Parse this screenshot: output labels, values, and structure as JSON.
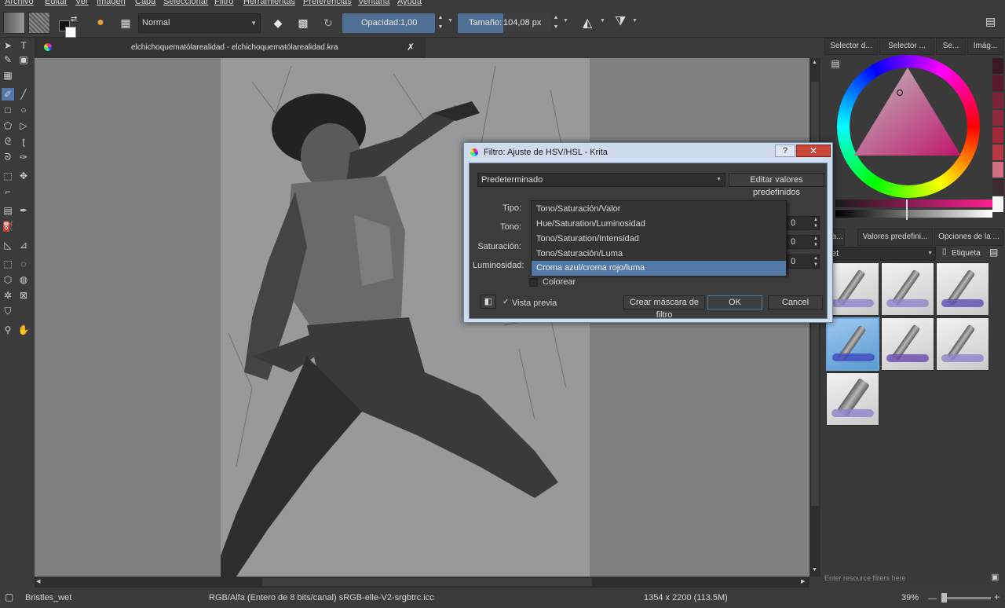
{
  "menu": [
    "Archivo",
    "Editar",
    "Ver",
    "Imagen",
    "Capa",
    "Seleccionar",
    "Filtro",
    "Herramientas",
    "Preferencias",
    "Ventana",
    "Ayuda"
  ],
  "toolbar": {
    "blend_mode": "Normal",
    "opacity_label": "Opacidad:",
    "opacity_value": "1,00",
    "size_label": "Tamaño:",
    "size_value": "104,08 px"
  },
  "document": {
    "tab_title": "elchichoquematólarealidad - elchichoquematólarealidad.kra"
  },
  "right_panel": {
    "top_tabs": [
      "Selector d...",
      "Selector ...",
      "Se...",
      "Imág..."
    ],
    "preset_tabs": [
      "Ca...",
      "Valores predefini...",
      "Opciones de la ..."
    ],
    "preset_filter_value": "et",
    "tag_label": "Etiqueta",
    "resource_filter_placeholder": "Enter resource filters here",
    "swatch_colors": [
      "#3a1a22",
      "#5a1a2a",
      "#7a2638",
      "#8a2c3c",
      "#a02a3a",
      "#b83848",
      "#d07080",
      "#3b2a2e",
      "#f5f5f5"
    ]
  },
  "dialog": {
    "title": "Filtro: Ajuste de HSV/HSL - Krita",
    "preset_value": "Predeterminado",
    "edit_presets_button": "Editar valores predefinidos",
    "type_label": "Tipo:",
    "hue_label": "Tono:",
    "saturation_label": "Saturación:",
    "luminosity_label": "Luminosidad:",
    "hue_value": "0",
    "saturation_value": "0",
    "luminosity_value": "0",
    "colorize_label": "Colorear",
    "preview_label": "Vista previa",
    "preview_checked": true,
    "mask_button": "Crear máscara de filtro",
    "ok_button": "OK",
    "cancel_button": "Cancel",
    "type_options": [
      "Tono/Saturación/Valor",
      "Hue/Saturation/Luminosidad",
      "Tono/Saturation/Intensidad",
      "Tono/Saturación/Luma",
      "Croma azul/croma rojo/luma"
    ],
    "selected_option_index": 4
  },
  "status": {
    "brush_name": "Bristles_wet",
    "color_model": "RGB/Alfa (Entero de 8 bits/canal)  sRGB-elle-V2-srgbtrc.icc",
    "dimensions": "1354 x 2200 (113.5M)",
    "zoom": "39%"
  },
  "accent_color": "#4f6f95"
}
